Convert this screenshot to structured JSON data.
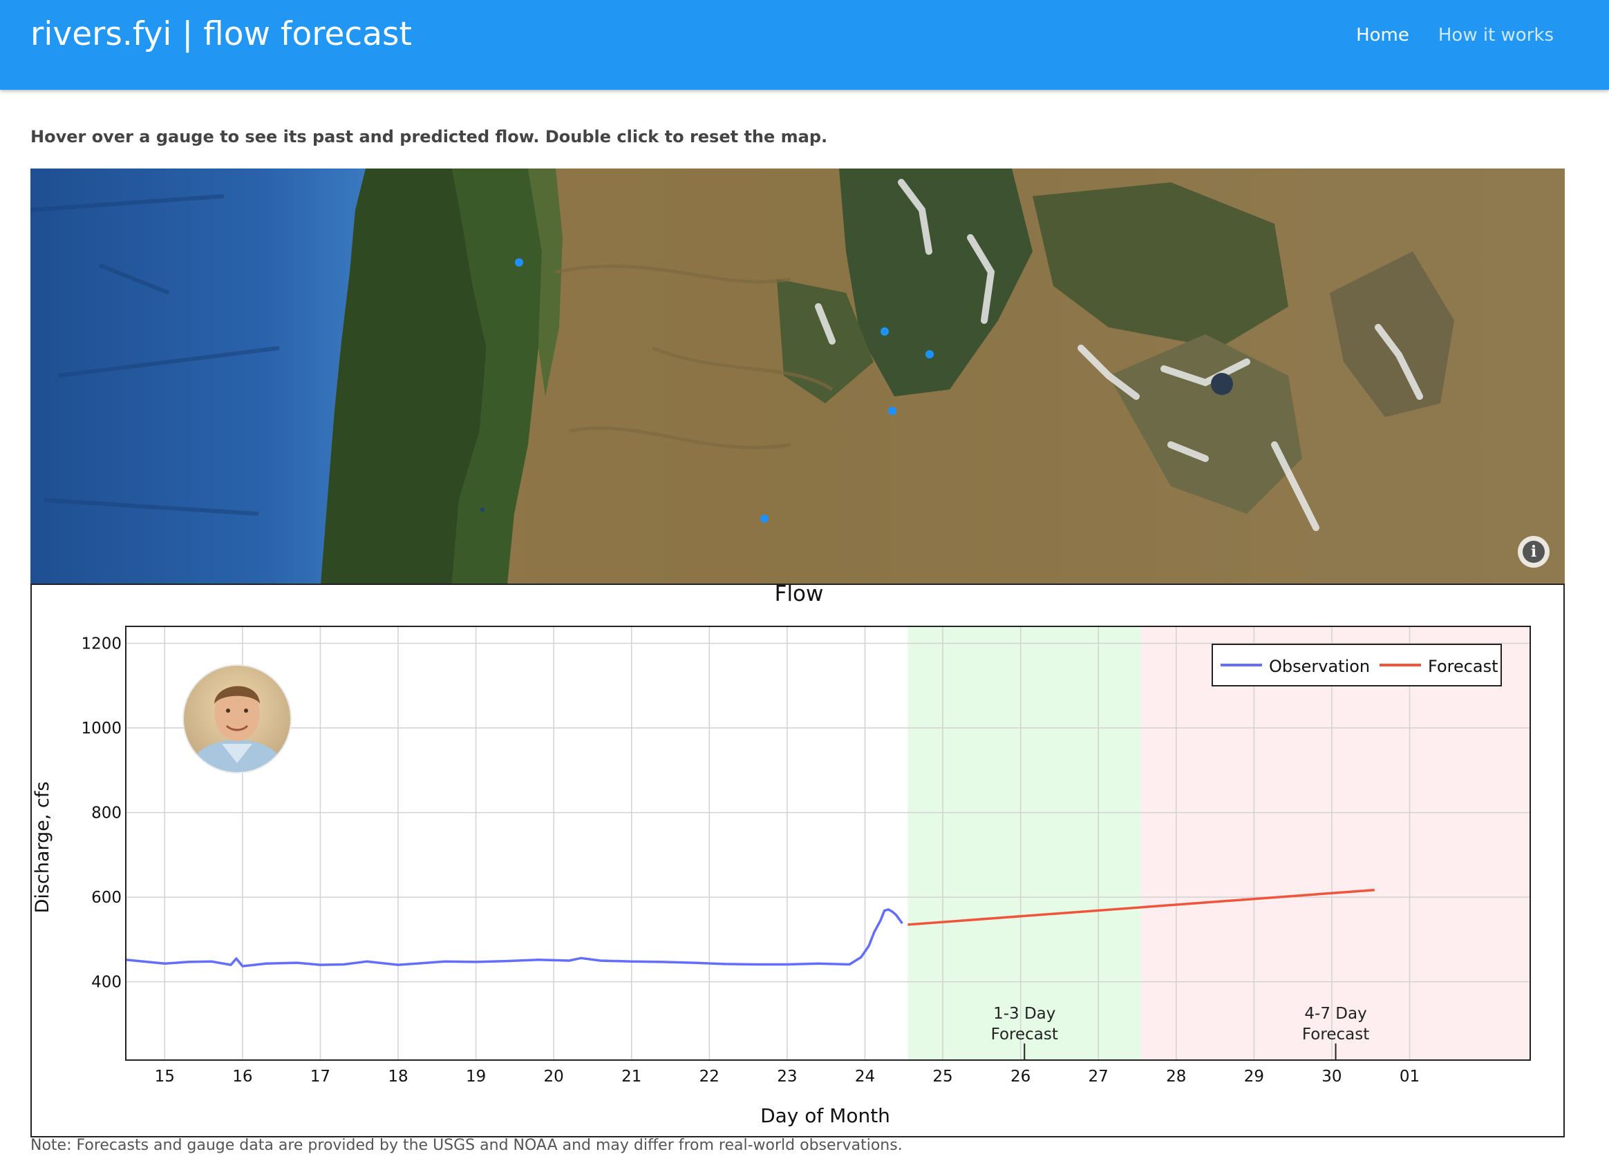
{
  "app": {
    "brand": "rivers.fyi | flow forecast"
  },
  "nav": {
    "items": [
      {
        "label": "Home",
        "active": true
      },
      {
        "label": "How it works",
        "active": false
      }
    ]
  },
  "instructions": "Hover over a gauge to see its past and predicted flow. Double click to reset the map.",
  "map": {
    "gauge_color": "#1e90ff",
    "info_icon": "info-icon",
    "gauge_count": 6
  },
  "colors": {
    "navbar": "#2196f3",
    "observation": "#636efa",
    "forecast": "#ef553b",
    "band_1_3": "#e6fbe6",
    "band_4_7": "#ffeef0"
  },
  "chart_data": {
    "type": "line",
    "title": "Flow",
    "xlabel": "Day of Month",
    "ylabel": "Discharge, cfs",
    "x_ticks": [
      "15",
      "16",
      "17",
      "18",
      "19",
      "20",
      "21",
      "22",
      "23",
      "24",
      "25",
      "26",
      "27",
      "28",
      "29",
      "30",
      "01"
    ],
    "xlim": [
      14.5,
      32.55
    ],
    "ylim": [
      215,
      1240
    ],
    "y_ticks": [
      400,
      600,
      800,
      1000,
      1200
    ],
    "grid": true,
    "legend_position": "top-right",
    "series": [
      {
        "name": "Observation",
        "color": "#636efa",
        "x": [
          14.5,
          15.0,
          15.3,
          15.6,
          15.85,
          15.92,
          16.0,
          16.3,
          16.7,
          17.0,
          17.3,
          17.6,
          18.0,
          18.3,
          18.6,
          19.0,
          19.4,
          19.8,
          20.2,
          20.35,
          20.6,
          21.0,
          21.4,
          21.8,
          22.2,
          22.6,
          23.0,
          23.4,
          23.8,
          23.95,
          24.05,
          24.12,
          24.2,
          24.25,
          24.3,
          24.35,
          24.4,
          24.48
        ],
        "y": [
          452,
          443,
          447,
          448,
          440,
          455,
          437,
          443,
          445,
          440,
          441,
          448,
          440,
          444,
          448,
          447,
          449,
          452,
          450,
          456,
          450,
          448,
          447,
          445,
          442,
          441,
          441,
          443,
          441,
          458,
          485,
          518,
          545,
          568,
          571,
          566,
          558,
          538
        ]
      },
      {
        "name": "Forecast",
        "color": "#ef553b",
        "x": [
          24.55,
          30.55
        ],
        "y": [
          535,
          617
        ]
      }
    ],
    "bands": [
      {
        "label": "1-3 Day Forecast",
        "x_start": 24.55,
        "x_end": 27.55
      },
      {
        "label": "4-7 Day Forecast",
        "x_start": 27.55,
        "x_end": 32.55
      }
    ]
  },
  "footer_note": "Note: Forecasts and gauge data are provided by the USGS and NOAA and may differ from real-world observations."
}
